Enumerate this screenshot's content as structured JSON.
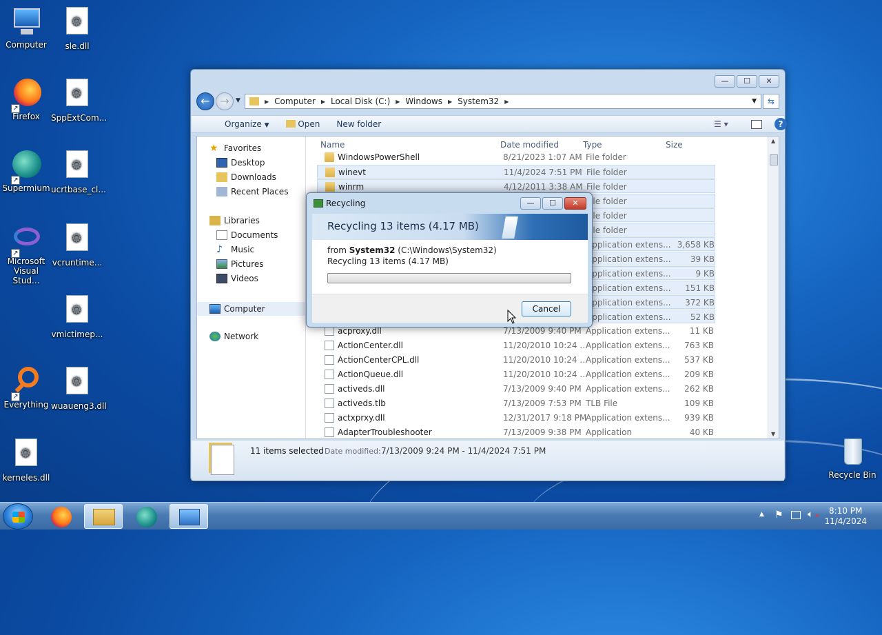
{
  "desktop": {
    "icons": [
      {
        "label": "Computer"
      },
      {
        "label": "sle.dll"
      },
      {
        "label": "Firefox"
      },
      {
        "label": "SppExtCom..."
      },
      {
        "label": "Supermium"
      },
      {
        "label": "ucrtbase_cl..."
      },
      {
        "label": "Microsoft Visual Stud..."
      },
      {
        "label": "vcruntime..."
      },
      {
        "label": "vmictimep..."
      },
      {
        "label": "Everything"
      },
      {
        "label": "wuaueng3.dll"
      },
      {
        "label": "kerneles.dll"
      },
      {
        "label": "Recycle Bin"
      }
    ]
  },
  "explorer": {
    "window_buttons": {
      "minimize": "—",
      "maximize": "☐",
      "close": "✕"
    },
    "breadcrumb": [
      "Computer",
      "Local Disk (C:)",
      "Windows",
      "System32"
    ],
    "toolbar": {
      "organize": "Organize",
      "open": "Open",
      "new_folder": "New folder"
    },
    "nav": {
      "favorites": "Favorites",
      "desktop": "Desktop",
      "downloads": "Downloads",
      "recent_places": "Recent Places",
      "libraries": "Libraries",
      "documents": "Documents",
      "music": "Music",
      "pictures": "Pictures",
      "videos": "Videos",
      "computer": "Computer",
      "network": "Network"
    },
    "columns": {
      "name": "Name",
      "date": "Date modified",
      "type": "Type",
      "size": "Size"
    },
    "rows": [
      {
        "name": "WindowsPowerShell",
        "date": "8/21/2023 1:07 AM",
        "type": "File folder",
        "size": ""
      },
      {
        "name": "winevt",
        "date": "11/4/2024 7:51 PM",
        "type": "File folder",
        "size": ""
      },
      {
        "name": "winrm",
        "date": "4/12/2011 3:38 AM",
        "type": "File folder",
        "size": ""
      },
      {
        "name": "",
        "date": "",
        "type": "File folder",
        "size": ""
      },
      {
        "name": "",
        "date": "",
        "type": "File folder",
        "size": ""
      },
      {
        "name": "",
        "date": "",
        "type": "File folder",
        "size": ""
      },
      {
        "name": "",
        "date": "",
        "type": "Application extens...",
        "size": "3,658 KB"
      },
      {
        "name": "",
        "date": "",
        "type": "Application extens...",
        "size": "39 KB"
      },
      {
        "name": "",
        "date": "",
        "type": "Application extens...",
        "size": "9 KB"
      },
      {
        "name": "",
        "date": "",
        "type": "Application extens...",
        "size": "151 KB"
      },
      {
        "name": "",
        "date": "",
        "type": "Application extens...",
        "size": "372 KB"
      },
      {
        "name": "",
        "date": "",
        "type": "Application extens...",
        "size": "52 KB"
      },
      {
        "name": "acproxy.dll",
        "date": "7/13/2009 9:40 PM",
        "type": "Application extens...",
        "size": "11 KB"
      },
      {
        "name": "ActionCenter.dll",
        "date": "11/20/2010 10:24 ...",
        "type": "Application extens...",
        "size": "763 KB"
      },
      {
        "name": "ActionCenterCPL.dll",
        "date": "11/20/2010 10:24 ...",
        "type": "Application extens...",
        "size": "537 KB"
      },
      {
        "name": "ActionQueue.dll",
        "date": "11/20/2010 10:24 ...",
        "type": "Application extens...",
        "size": "209 KB"
      },
      {
        "name": "activeds.dll",
        "date": "7/13/2009 9:40 PM",
        "type": "Application extens...",
        "size": "262 KB"
      },
      {
        "name": "activeds.tlb",
        "date": "7/13/2009 7:53 PM",
        "type": "TLB File",
        "size": "109 KB"
      },
      {
        "name": "actxprxy.dll",
        "date": "12/31/2017 9:18 PM",
        "type": "Application extens...",
        "size": "939 KB"
      },
      {
        "name": "AdapterTroubleshooter",
        "date": "7/13/2009 9:38 PM",
        "type": "Application",
        "size": "40 KB"
      }
    ],
    "status": {
      "selected": "11 items selected",
      "date_label": "Date modified:",
      "date_range": "7/13/2009 9:24 PM - 11/4/2024 7:51 PM"
    }
  },
  "dialog": {
    "title": "Recycling",
    "window_buttons": {
      "minimize": "—",
      "maximize": "☐",
      "close": "✕"
    },
    "heading": "Recycling 13 items (4.17 MB)",
    "from_label": "from",
    "from_folder": "System32",
    "from_path": "(C:\\Windows\\System32)",
    "status": "Recycling 13 items (4.17 MB)",
    "progress": 0,
    "cancel": "Cancel"
  },
  "taskbar": {
    "time": "8:10 PM",
    "date": "11/4/2024"
  }
}
